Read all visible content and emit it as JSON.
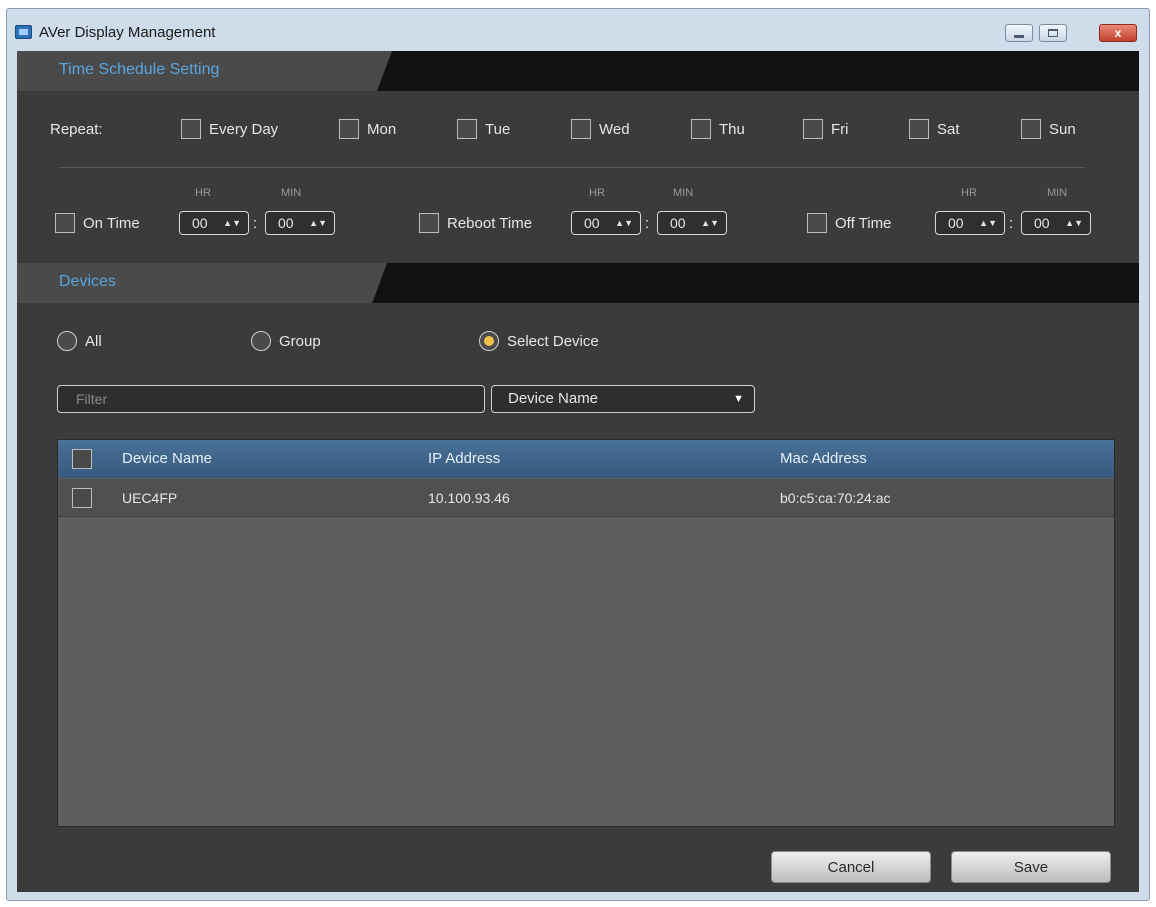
{
  "window": {
    "title": "AVer Display Management",
    "close_glyph": "x"
  },
  "schedule": {
    "section_title": "Time Schedule Setting",
    "repeat_label": "Repeat:",
    "days": [
      "Every Day",
      "Mon",
      "Tue",
      "Wed",
      "Thu",
      "Fri",
      "Sat",
      "Sun"
    ],
    "hr_label": "HR",
    "min_label": "MIN",
    "colon": ":",
    "spin_arrows": "▲▼",
    "on_time": {
      "label": "On Time",
      "hr": "00",
      "min": "00"
    },
    "reboot_time": {
      "label": "Reboot Time",
      "hr": "00",
      "min": "00"
    },
    "off_time": {
      "label": "Off Time",
      "hr": "00",
      "min": "00"
    }
  },
  "devices": {
    "section_title": "Devices",
    "scope_options": [
      "All",
      "Group",
      "Select Device"
    ],
    "selected_scope": "Select Device",
    "filter_placeholder": "Filter",
    "filter_field": "Device Name",
    "select_arrow": "▼",
    "columns": [
      "Device Name",
      "IP Address",
      "Mac Address"
    ],
    "rows": [
      {
        "name": "UEC4FP",
        "ip": "10.100.93.46",
        "mac": "b0:c5:ca:70:24:ac"
      }
    ]
  },
  "actions": {
    "cancel": "Cancel",
    "save": "Save"
  }
}
